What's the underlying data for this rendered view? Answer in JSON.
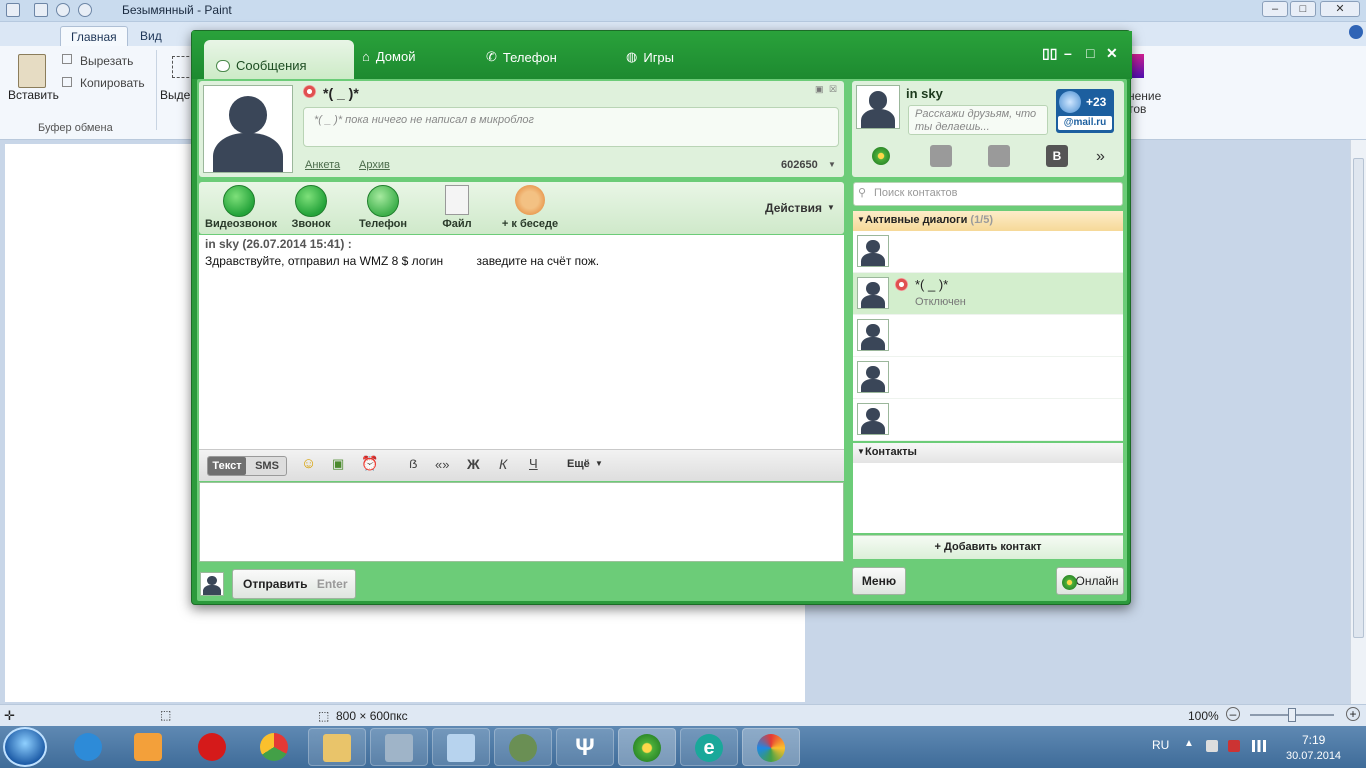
{
  "paint": {
    "title": "Безымянный - Paint",
    "tabs": [
      "Главная",
      "Вид"
    ],
    "clipboard": {
      "paste": "Вставить",
      "cut": "Вырезать",
      "copy": "Копировать",
      "group": "Буфер обмена"
    },
    "select_partial": "Выде",
    "right_partial_1": "нение",
    "right_partial_2": "тов",
    "status": {
      "size": "800 × 600пкс",
      "zoom": "100%"
    }
  },
  "taskbar": {
    "lang": "RU",
    "time": "7:19",
    "date": "30.07.2014"
  },
  "icq": {
    "tabs": [
      "Сообщения",
      "Домой",
      "Телефон",
      "Игры"
    ],
    "contact": {
      "name": "*( _ )*",
      "microblog": "*( _ )* пока ничего не написал в микроблог",
      "link_profile": "Анкета",
      "link_archive": "Архив",
      "uin": "602650"
    },
    "actions": [
      "Видеозвонок",
      "Звонок",
      "Телефон",
      "Файл",
      "+ к беседе"
    ],
    "actions_menu": "Действия",
    "message": {
      "header": "in sky (26.07.2014 15:41) :",
      "text": "Здравствуйте, отправил на WMZ 8 $ логин          заведите на счёт пож."
    },
    "toolbar": {
      "text_tab": "Текст",
      "sms_tab": "SMS",
      "more": "Ещё"
    },
    "send": {
      "label": "Отправить",
      "hint": "Enter"
    },
    "self": {
      "name": "in sky",
      "status_placeholder": "Расскажи друзьям, что ты делаешь...",
      "mail_count": "+23",
      "mail_brand": "@mail.ru"
    },
    "search_placeholder": "Поиск контактов",
    "active_dialogs": {
      "label": "Активные диалоги",
      "count": "(1/5)"
    },
    "dialogs": [
      {
        "name": "",
        "status": ""
      },
      {
        "name": "*( _ )*",
        "status": "Отключен"
      },
      {
        "name": "",
        "status": ""
      },
      {
        "name": "",
        "status": ""
      },
      {
        "name": "",
        "status": ""
      }
    ],
    "contacts_label": "Контакты",
    "add_contact": "+ Добавить контакт",
    "menu_button": "Меню",
    "online_button": "Онлайн"
  }
}
